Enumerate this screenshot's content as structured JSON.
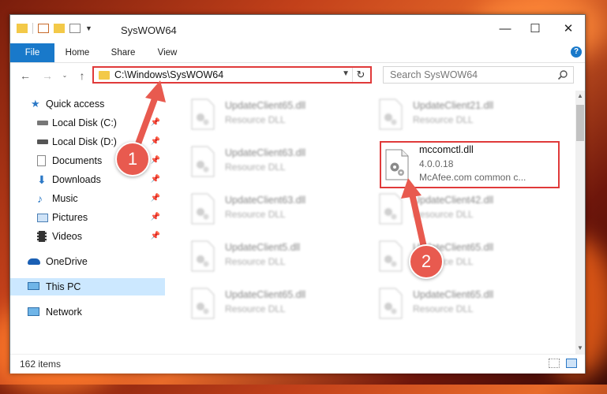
{
  "window": {
    "title": "SysWOW64"
  },
  "ribbon": {
    "tabs": [
      "File",
      "Home",
      "Share",
      "View"
    ],
    "help": "?"
  },
  "address": {
    "path": "C:\\Windows\\SysWOW64",
    "search_placeholder": "Search SysWOW64"
  },
  "nav": {
    "items": [
      {
        "label": "Quick access",
        "icon": "star-icon"
      },
      {
        "label": "Local Disk (C:)",
        "icon": "drive-icon",
        "pinned": true
      },
      {
        "label": "Local Disk (D:)",
        "icon": "drive-icon",
        "pinned": true
      },
      {
        "label": "Documents",
        "icon": "documents-icon",
        "pinned": true
      },
      {
        "label": "Downloads",
        "icon": "downloads-icon",
        "pinned": true
      },
      {
        "label": "Music",
        "icon": "music-icon",
        "pinned": true
      },
      {
        "label": "Pictures",
        "icon": "pictures-icon",
        "pinned": true
      },
      {
        "label": "Videos",
        "icon": "videos-icon",
        "pinned": true
      },
      {
        "label": "OneDrive",
        "icon": "onedrive-icon"
      },
      {
        "label": "This PC",
        "icon": "computer-icon",
        "selected": true
      },
      {
        "label": "Network",
        "icon": "network-icon"
      }
    ]
  },
  "files": {
    "left": [
      {
        "name": "UpdateClient65.dll",
        "sub": "Resource DLL"
      },
      {
        "name": "UpdateClient63.dll",
        "sub": "Resource DLL"
      },
      {
        "name": "UpdateClient63.dll",
        "sub": "Resource DLL"
      },
      {
        "name": "UpdateClient5.dll",
        "sub": "Resource DLL"
      },
      {
        "name": "UpdateClient65.dll",
        "sub": "Resource DLL"
      }
    ],
    "right": [
      {
        "name": "UpdateClient21.dll",
        "sub": "Resource DLL"
      },
      {
        "name": "UpdateClient42.dll",
        "sub": "Resource DLL"
      },
      {
        "name": "UpdateClient65.dll",
        "sub": "Resource DLL"
      },
      {
        "name": "UpdateClient65.dll",
        "sub": "Resource DLL"
      }
    ],
    "highlighted": {
      "name": "mccomctl.dll",
      "version": "4.0.0.18",
      "description": "McAfee.com common c..."
    }
  },
  "status": {
    "count": "162 items"
  },
  "annotations": {
    "badge1": "1",
    "badge2": "2"
  },
  "colors": {
    "accent": "#1979ca",
    "highlight": "#e03a3a",
    "badge": "#e85a4f"
  }
}
